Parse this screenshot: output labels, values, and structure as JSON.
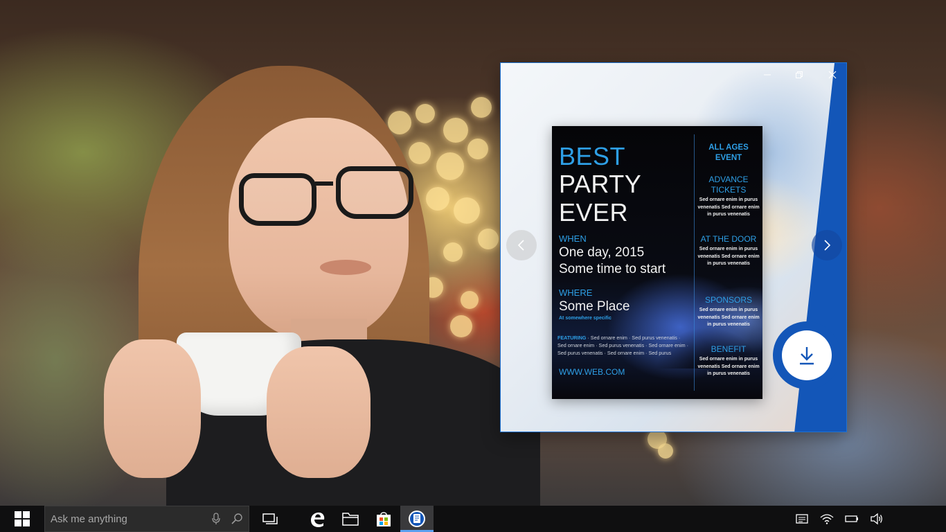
{
  "window": {
    "controls": {
      "minimize_icon": "minimize-icon",
      "restore_icon": "restore-icon",
      "close_icon": "close-icon"
    },
    "accent_color": "#1356b8"
  },
  "flyer": {
    "title_line1": "BEST",
    "title_line2": "PARTY",
    "title_line3": "EVER",
    "when_label": "WHEN",
    "when_line1": "One day, 2015",
    "when_line2": "Some time to start",
    "where_label": "WHERE",
    "where_value": "Some Place",
    "where_sub": "At somewhere specific",
    "featuring_label": "FEATURING",
    "featuring_text": " · Sed ornare enim · Sed purus venenatis · Sed ornare enim · Sed purus venenatis · Sed ornare enim · Sed purus venenatis · Sed ornare enim · Sed purus",
    "url": "WWW.WEB.COM",
    "side": [
      {
        "heading": "ALL AGES EVENT",
        "text": ""
      },
      {
        "heading": "ADVANCE TICKETS",
        "text": "Sed ornare enim in purus venenatis Sed ornare enim in purus venenatis"
      },
      {
        "heading": "AT THE DOOR",
        "text": "Sed ornare enim in purus venenatis Sed ornare enim in purus venenatis"
      },
      {
        "heading": "SPONSORS",
        "text": "Sed ornare enim in purus venenatis Sed ornare enim in purus venenatis"
      },
      {
        "heading": "BENEFIT",
        "text": "Sed ornare enim in purus venenatis Sed ornare enim in purus venenatis"
      }
    ],
    "accent_color": "#2e9fe6"
  },
  "navigation": {
    "prev_icon": "chevron-left-icon",
    "next_icon": "chevron-right-icon"
  },
  "download": {
    "icon": "download-icon"
  },
  "taskbar": {
    "search_placeholder": "Ask me anything",
    "apps": [
      "task-view",
      "edge",
      "file-explorer",
      "store",
      "flyer-app"
    ],
    "tray": [
      "action-center",
      "wifi",
      "battery",
      "volume"
    ]
  }
}
